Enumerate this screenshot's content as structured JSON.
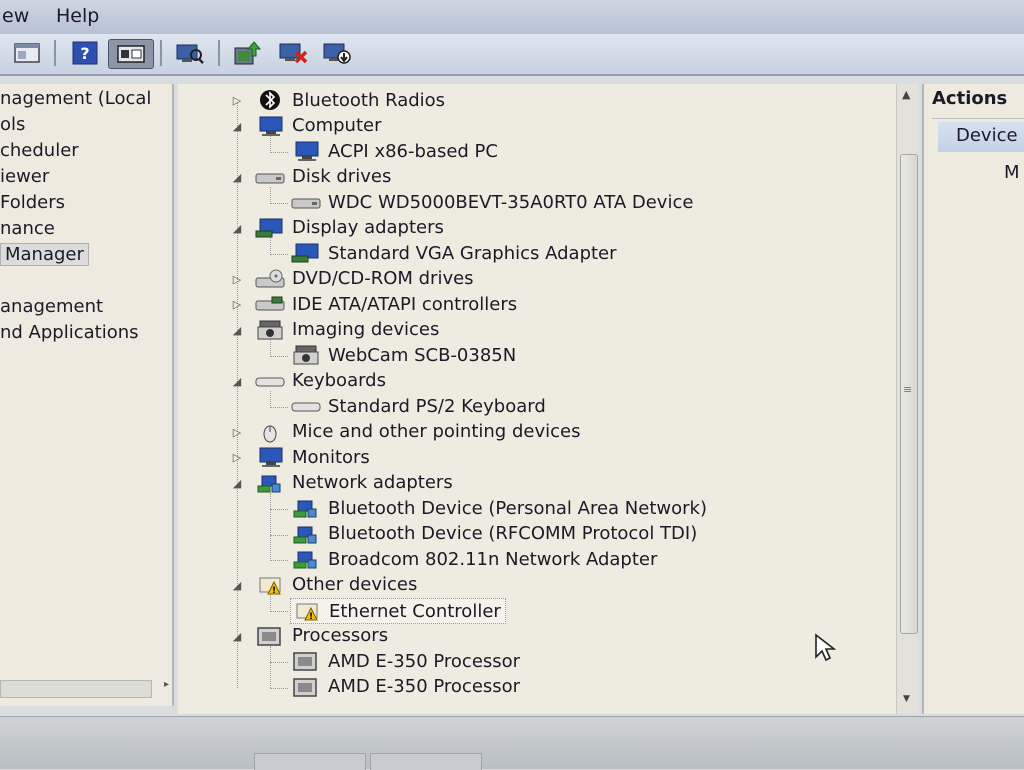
{
  "menu": {
    "items": [
      "ew",
      "Help"
    ]
  },
  "toolbar": {
    "buttons": [
      "console-tree-icon",
      "help-icon",
      "view-icon",
      "scan-hardware-icon",
      "update-driver-icon",
      "disable-device-icon",
      "uninstall-device-icon"
    ]
  },
  "left_pane": {
    "items": [
      "nagement (Local",
      "ols",
      "cheduler",
      "iewer",
      " Folders",
      "nance",
      " Manager",
      "",
      "anagement",
      "nd Applications"
    ],
    "selected": " Manager"
  },
  "device_tree": {
    "categories": [
      {
        "label": "Bluetooth Radios",
        "expanded": false,
        "icon": "bluetooth-icon",
        "children": []
      },
      {
        "label": "Computer",
        "expanded": true,
        "icon": "computer-icon",
        "children": [
          "ACPI x86-based PC"
        ]
      },
      {
        "label": "Disk drives",
        "expanded": true,
        "icon": "disk-drive-icon",
        "children": [
          "WDC WD5000BEVT-35A0RT0 ATA Device"
        ]
      },
      {
        "label": "Display adapters",
        "expanded": true,
        "icon": "display-adapter-icon",
        "children": [
          "Standard VGA Graphics Adapter"
        ]
      },
      {
        "label": "DVD/CD-ROM drives",
        "expanded": false,
        "icon": "dvd-drive-icon",
        "children": []
      },
      {
        "label": "IDE ATA/ATAPI controllers",
        "expanded": false,
        "icon": "ide-controller-icon",
        "children": []
      },
      {
        "label": "Imaging devices",
        "expanded": true,
        "icon": "camera-icon",
        "children": [
          "WebCam SCB-0385N"
        ]
      },
      {
        "label": "Keyboards",
        "expanded": true,
        "icon": "keyboard-icon",
        "children": [
          "Standard PS/2 Keyboard"
        ]
      },
      {
        "label": "Mice and other pointing devices",
        "expanded": false,
        "icon": "mouse-icon",
        "children": []
      },
      {
        "label": "Monitors",
        "expanded": false,
        "icon": "monitor-icon",
        "children": []
      },
      {
        "label": "Network adapters",
        "expanded": true,
        "icon": "network-adapter-icon",
        "children": [
          "Bluetooth Device (Personal Area Network)",
          "Bluetooth Device (RFCOMM Protocol TDI)",
          "Broadcom 802.11n Network Adapter"
        ]
      },
      {
        "label": "Other devices",
        "expanded": true,
        "icon": "unknown-device-icon",
        "children": [
          "Ethernet Controller"
        ]
      },
      {
        "label": "Processors",
        "expanded": true,
        "icon": "processor-icon",
        "children": [
          "AMD E-350 Processor",
          "AMD E-350 Processor"
        ]
      }
    ],
    "selected": "Ethernet Controller"
  },
  "actions_pane": {
    "header": "Actions",
    "subheader": "Device",
    "more": "M"
  },
  "colors": {
    "pane_background": "#eeebe0",
    "menu_background": "#c7d0df",
    "actions_highlight": "#c8d6e8"
  }
}
